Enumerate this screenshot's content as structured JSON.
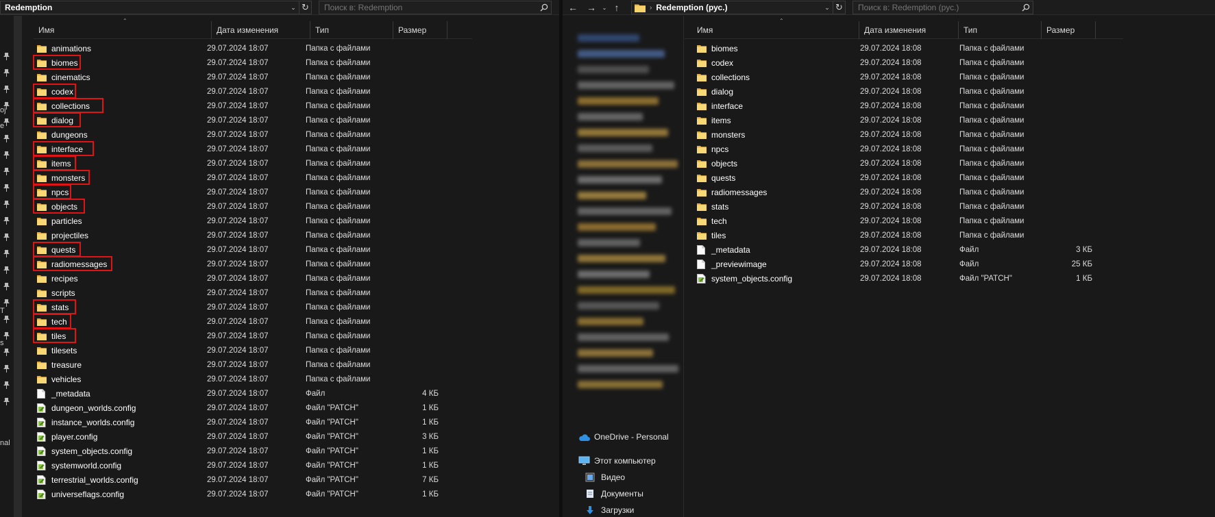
{
  "left": {
    "address": "Redemption",
    "search_placeholder": "Поиск в: Redemption",
    "columns": {
      "name": "Имя",
      "date": "Дата изменения",
      "type": "Тип",
      "size": "Размер"
    },
    "edge_labels": [
      "ој",
      "е",
      "Т",
      "s",
      "nal"
    ],
    "items": [
      {
        "name": "animations",
        "date": "29.07.2024 18:07",
        "type": "Папка с файлами",
        "size": "",
        "kind": "folder",
        "hl": false
      },
      {
        "name": "biomes",
        "date": "29.07.2024 18:07",
        "type": "Папка с файлами",
        "size": "",
        "kind": "folder",
        "hl": true
      },
      {
        "name": "cinematics",
        "date": "29.07.2024 18:07",
        "type": "Папка с файлами",
        "size": "",
        "kind": "folder",
        "hl": false
      },
      {
        "name": "codex",
        "date": "29.07.2024 18:07",
        "type": "Папка с файлами",
        "size": "",
        "kind": "folder",
        "hl": true
      },
      {
        "name": "collections",
        "date": "29.07.2024 18:07",
        "type": "Папка с файлами",
        "size": "",
        "kind": "folder",
        "hl": true
      },
      {
        "name": "dialog",
        "date": "29.07.2024 18:07",
        "type": "Папка с файлами",
        "size": "",
        "kind": "folder",
        "hl": true
      },
      {
        "name": "dungeons",
        "date": "29.07.2024 18:07",
        "type": "Папка с файлами",
        "size": "",
        "kind": "folder",
        "hl": false
      },
      {
        "name": "interface",
        "date": "29.07.2024 18:07",
        "type": "Папка с файлами",
        "size": "",
        "kind": "folder",
        "hl": true
      },
      {
        "name": "items",
        "date": "29.07.2024 18:07",
        "type": "Папка с файлами",
        "size": "",
        "kind": "folder",
        "hl": true
      },
      {
        "name": "monsters",
        "date": "29.07.2024 18:07",
        "type": "Папка с файлами",
        "size": "",
        "kind": "folder",
        "hl": true
      },
      {
        "name": "npcs",
        "date": "29.07.2024 18:07",
        "type": "Папка с файлами",
        "size": "",
        "kind": "folder",
        "hl": true
      },
      {
        "name": "objects",
        "date": "29.07.2024 18:07",
        "type": "Папка с файлами",
        "size": "",
        "kind": "folder",
        "hl": true
      },
      {
        "name": "particles",
        "date": "29.07.2024 18:07",
        "type": "Папка с файлами",
        "size": "",
        "kind": "folder",
        "hl": false
      },
      {
        "name": "projectiles",
        "date": "29.07.2024 18:07",
        "type": "Папка с файлами",
        "size": "",
        "kind": "folder",
        "hl": false
      },
      {
        "name": "quests",
        "date": "29.07.2024 18:07",
        "type": "Папка с файлами",
        "size": "",
        "kind": "folder",
        "hl": true
      },
      {
        "name": "radiomessages",
        "date": "29.07.2024 18:07",
        "type": "Папка с файлами",
        "size": "",
        "kind": "folder",
        "hl": true
      },
      {
        "name": "recipes",
        "date": "29.07.2024 18:07",
        "type": "Папка с файлами",
        "size": "",
        "kind": "folder",
        "hl": false
      },
      {
        "name": "scripts",
        "date": "29.07.2024 18:07",
        "type": "Папка с файлами",
        "size": "",
        "kind": "folder",
        "hl": false
      },
      {
        "name": "stats",
        "date": "29.07.2024 18:07",
        "type": "Папка с файлами",
        "size": "",
        "kind": "folder",
        "hl": true
      },
      {
        "name": "tech",
        "date": "29.07.2024 18:07",
        "type": "Папка с файлами",
        "size": "",
        "kind": "folder",
        "hl": true
      },
      {
        "name": "tiles",
        "date": "29.07.2024 18:07",
        "type": "Папка с файлами",
        "size": "",
        "kind": "folder",
        "hl": true
      },
      {
        "name": "tilesets",
        "date": "29.07.2024 18:07",
        "type": "Папка с файлами",
        "size": "",
        "kind": "folder",
        "hl": false
      },
      {
        "name": "treasure",
        "date": "29.07.2024 18:07",
        "type": "Папка с файлами",
        "size": "",
        "kind": "folder",
        "hl": false
      },
      {
        "name": "vehicles",
        "date": "29.07.2024 18:07",
        "type": "Папка с файлами",
        "size": "",
        "kind": "folder",
        "hl": false
      },
      {
        "name": "_metadata",
        "date": "29.07.2024 18:07",
        "type": "Файл",
        "size": "4 КБ",
        "kind": "file",
        "hl": false
      },
      {
        "name": "dungeon_worlds.config",
        "date": "29.07.2024 18:07",
        "type": "Файл \"PATCH\"",
        "size": "1 КБ",
        "kind": "config",
        "hl": false
      },
      {
        "name": "instance_worlds.config",
        "date": "29.07.2024 18:07",
        "type": "Файл \"PATCH\"",
        "size": "1 КБ",
        "kind": "config",
        "hl": false
      },
      {
        "name": "player.config",
        "date": "29.07.2024 18:07",
        "type": "Файл \"PATCH\"",
        "size": "3 КБ",
        "kind": "config",
        "hl": false
      },
      {
        "name": "system_objects.config",
        "date": "29.07.2024 18:07",
        "type": "Файл \"PATCH\"",
        "size": "1 КБ",
        "kind": "config",
        "hl": false
      },
      {
        "name": "systemworld.config",
        "date": "29.07.2024 18:07",
        "type": "Файл \"PATCH\"",
        "size": "1 КБ",
        "kind": "config",
        "hl": false
      },
      {
        "name": "terrestrial_worlds.config",
        "date": "29.07.2024 18:07",
        "type": "Файл \"PATCH\"",
        "size": "7 КБ",
        "kind": "config",
        "hl": false
      },
      {
        "name": "universeflags.config",
        "date": "29.07.2024 18:07",
        "type": "Файл \"PATCH\"",
        "size": "1 КБ",
        "kind": "config",
        "hl": false
      }
    ]
  },
  "right": {
    "address": "Redemption (рус.)",
    "search_placeholder": "Поиск в: Redemption (рус.)",
    "columns": {
      "name": "Имя",
      "date": "Дата изменения",
      "type": "Тип",
      "size": "Размер"
    },
    "nav": {
      "onedrive": "OneDrive - Personal",
      "this_pc": "Этот компьютер",
      "video": "Видео",
      "documents": "Документы",
      "downloads": "Загрузки"
    },
    "items": [
      {
        "name": "biomes",
        "date": "29.07.2024 18:08",
        "type": "Папка с файлами",
        "size": "",
        "kind": "folder"
      },
      {
        "name": "codex",
        "date": "29.07.2024 18:08",
        "type": "Папка с файлами",
        "size": "",
        "kind": "folder"
      },
      {
        "name": "collections",
        "date": "29.07.2024 18:08",
        "type": "Папка с файлами",
        "size": "",
        "kind": "folder"
      },
      {
        "name": "dialog",
        "date": "29.07.2024 18:08",
        "type": "Папка с файлами",
        "size": "",
        "kind": "folder"
      },
      {
        "name": "interface",
        "date": "29.07.2024 18:08",
        "type": "Папка с файлами",
        "size": "",
        "kind": "folder"
      },
      {
        "name": "items",
        "date": "29.07.2024 18:08",
        "type": "Папка с файлами",
        "size": "",
        "kind": "folder"
      },
      {
        "name": "monsters",
        "date": "29.07.2024 18:08",
        "type": "Папка с файлами",
        "size": "",
        "kind": "folder"
      },
      {
        "name": "npcs",
        "date": "29.07.2024 18:08",
        "type": "Папка с файлами",
        "size": "",
        "kind": "folder"
      },
      {
        "name": "objects",
        "date": "29.07.2024 18:08",
        "type": "Папка с файлами",
        "size": "",
        "kind": "folder"
      },
      {
        "name": "quests",
        "date": "29.07.2024 18:08",
        "type": "Папка с файлами",
        "size": "",
        "kind": "folder"
      },
      {
        "name": "radiomessages",
        "date": "29.07.2024 18:08",
        "type": "Папка с файлами",
        "size": "",
        "kind": "folder"
      },
      {
        "name": "stats",
        "date": "29.07.2024 18:08",
        "type": "Папка с файлами",
        "size": "",
        "kind": "folder"
      },
      {
        "name": "tech",
        "date": "29.07.2024 18:08",
        "type": "Папка с файлами",
        "size": "",
        "kind": "folder"
      },
      {
        "name": "tiles",
        "date": "29.07.2024 18:08",
        "type": "Папка с файлами",
        "size": "",
        "kind": "folder"
      },
      {
        "name": "_metadata",
        "date": "29.07.2024 18:08",
        "type": "Файл",
        "size": "3 КБ",
        "kind": "file"
      },
      {
        "name": "_previewimage",
        "date": "29.07.2024 18:08",
        "type": "Файл",
        "size": "25 КБ",
        "kind": "file"
      },
      {
        "name": "system_objects.config",
        "date": "29.07.2024 18:08",
        "type": "Файл \"PATCH\"",
        "size": "1 КБ",
        "kind": "config"
      }
    ]
  }
}
